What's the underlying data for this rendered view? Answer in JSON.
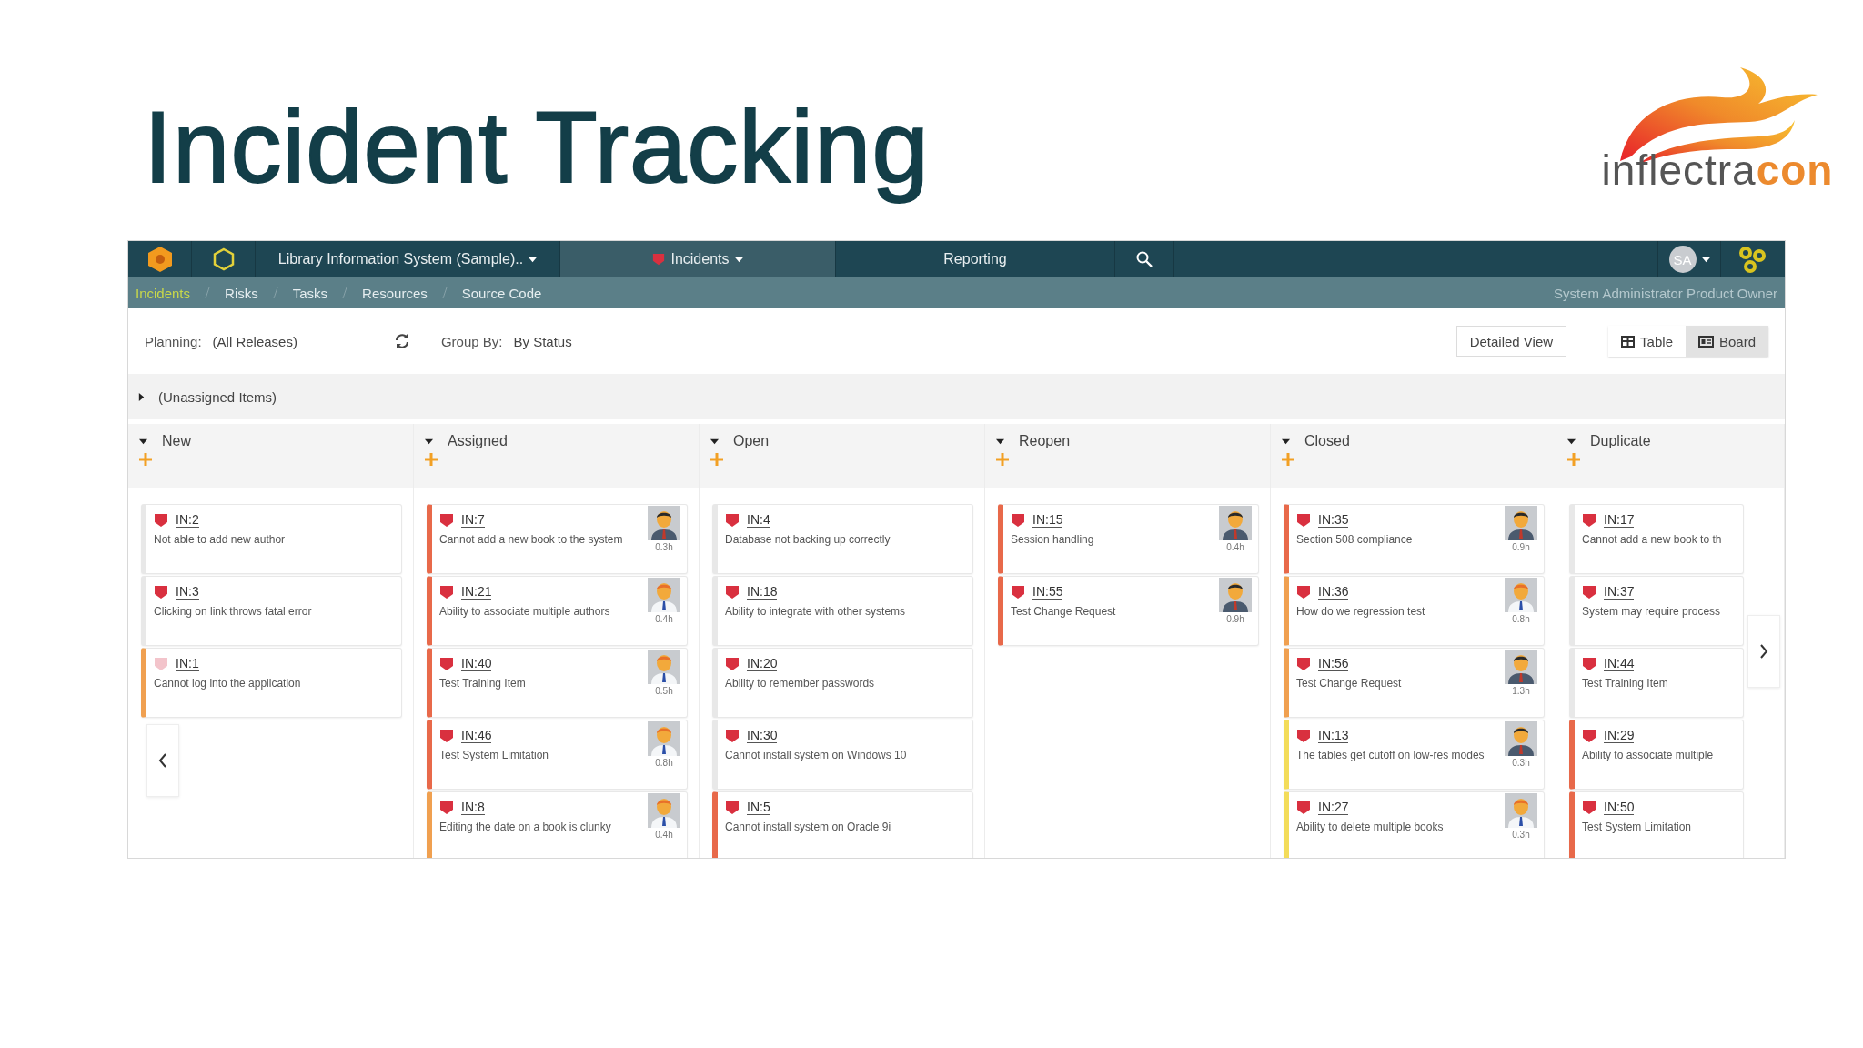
{
  "slide": {
    "title": "Incident Tracking",
    "logo": {
      "word": "inflectra",
      "accent": "con"
    }
  },
  "app": {
    "nav": {
      "project": "Library Information System (Sample)..",
      "tabs": [
        {
          "label": "Incidents",
          "selected": true
        },
        {
          "label": "Reporting",
          "selected": false
        }
      ],
      "avatar_initials": "SA"
    },
    "breadcrumbs": [
      {
        "label": "Incidents",
        "selected": true
      },
      {
        "label": "Risks",
        "selected": false
      },
      {
        "label": "Tasks",
        "selected": false
      },
      {
        "label": "Resources",
        "selected": false
      },
      {
        "label": "Source Code",
        "selected": false
      }
    ],
    "user_role": "System Administrator Product Owner",
    "toolbar": {
      "planning_label": "Planning:",
      "planning_value": "(All Releases)",
      "group_label": "Group By:",
      "group_value": "By Status",
      "detailed_view": "Detailed View",
      "view_toggle": [
        {
          "label": "Table",
          "kind": "table",
          "selected": false
        },
        {
          "label": "Board",
          "kind": "board",
          "selected": true
        }
      ]
    },
    "unassigned": {
      "label": "(Unassigned Items)",
      "expanded": false
    },
    "columns": [
      {
        "name": "New",
        "expanded": true,
        "cards": [
          {
            "id": "IN:2",
            "title": "Not able to add new author",
            "faded": false
          },
          {
            "id": "IN:3",
            "title": "Clicking on link throws fatal error",
            "faded": false
          },
          {
            "id": "IN:1",
            "title": "Cannot log into the application",
            "faded": true,
            "color": "#f0a050"
          }
        ]
      },
      {
        "name": "Assigned",
        "expanded": true,
        "cards": [
          {
            "id": "IN:7",
            "title": "Cannot add a new book to the system",
            "faded": false,
            "color": "#e8694a",
            "assignee": {
              "kind": "suit",
              "hours": "0.3h"
            }
          },
          {
            "id": "IN:21",
            "title": "Ability to associate multiple authors",
            "faded": false,
            "color": "#e8694a",
            "assignee": {
              "kind": "shirt",
              "hours": "0.4h"
            }
          },
          {
            "id": "IN:40",
            "title": "Test Training Item",
            "faded": false,
            "color": "#e8694a",
            "assignee": {
              "kind": "shirt",
              "hours": "0.5h"
            }
          },
          {
            "id": "IN:46",
            "title": "Test System Limitation",
            "faded": false,
            "color": "#e8694a",
            "assignee": {
              "kind": "shirt",
              "hours": "0.8h"
            }
          },
          {
            "id": "IN:8",
            "title": "Editing the date on a book is clunky",
            "faded": false,
            "color": "#f0a050",
            "assignee": {
              "kind": "shirt",
              "hours": "0.4h"
            }
          }
        ]
      },
      {
        "name": "Open",
        "expanded": true,
        "cards": [
          {
            "id": "IN:4",
            "title": "Database not backing up correctly",
            "faded": false
          },
          {
            "id": "IN:18",
            "title": "Ability to integrate with other systems",
            "faded": false
          },
          {
            "id": "IN:20",
            "title": "Ability to remember passwords",
            "faded": false
          },
          {
            "id": "IN:30",
            "title": "Cannot install system on Windows 10",
            "faded": false
          },
          {
            "id": "IN:5",
            "title": "Cannot install system on Oracle 9i",
            "faded": false,
            "color": "#e8694a"
          }
        ]
      },
      {
        "name": "Reopen",
        "expanded": true,
        "cards": [
          {
            "id": "IN:15",
            "title": "Session handling",
            "faded": false,
            "color": "#e8694a",
            "assignee": {
              "kind": "suit",
              "hours": "0.4h"
            }
          },
          {
            "id": "IN:55",
            "title": "Test Change Request",
            "faded": false,
            "color": "#e8694a",
            "assignee": {
              "kind": "suit",
              "hours": "0.9h"
            }
          }
        ]
      },
      {
        "name": "Closed",
        "expanded": true,
        "cards": [
          {
            "id": "IN:35",
            "title": "Section 508 compliance",
            "faded": false,
            "color": "#e8694a",
            "assignee": {
              "kind": "suit",
              "hours": "0.9h"
            }
          },
          {
            "id": "IN:36",
            "title": "How do we regression test",
            "faded": false,
            "color": "#f0a050",
            "assignee": {
              "kind": "shirt",
              "hours": "0.8h"
            }
          },
          {
            "id": "IN:56",
            "title": "Test Change Request",
            "faded": false,
            "color": "#f0a050",
            "assignee": {
              "kind": "suit",
              "hours": "1.3h"
            }
          },
          {
            "id": "IN:13",
            "title": "The tables get cutoff on low-res modes",
            "faded": false,
            "color": "#f3dc5a",
            "assignee": {
              "kind": "suit",
              "hours": "0.3h"
            }
          },
          {
            "id": "IN:27",
            "title": "Ability to delete multiple books",
            "faded": false,
            "color": "#f3dc5a",
            "assignee": {
              "kind": "shirt",
              "hours": "0.3h"
            }
          }
        ]
      },
      {
        "name": "Duplicate",
        "expanded": true,
        "cards": [
          {
            "id": "IN:17",
            "title": "Cannot add a new book to th",
            "faded": false
          },
          {
            "id": "IN:37",
            "title": "System may require process",
            "faded": false
          },
          {
            "id": "IN:44",
            "title": "Test Training Item",
            "faded": false
          },
          {
            "id": "IN:29",
            "title": "Ability to associate multiple",
            "faded": false,
            "color": "#e8694a"
          },
          {
            "id": "IN:50",
            "title": "Test System Limitation",
            "faded": false,
            "color": "#e8694a"
          }
        ]
      }
    ]
  }
}
